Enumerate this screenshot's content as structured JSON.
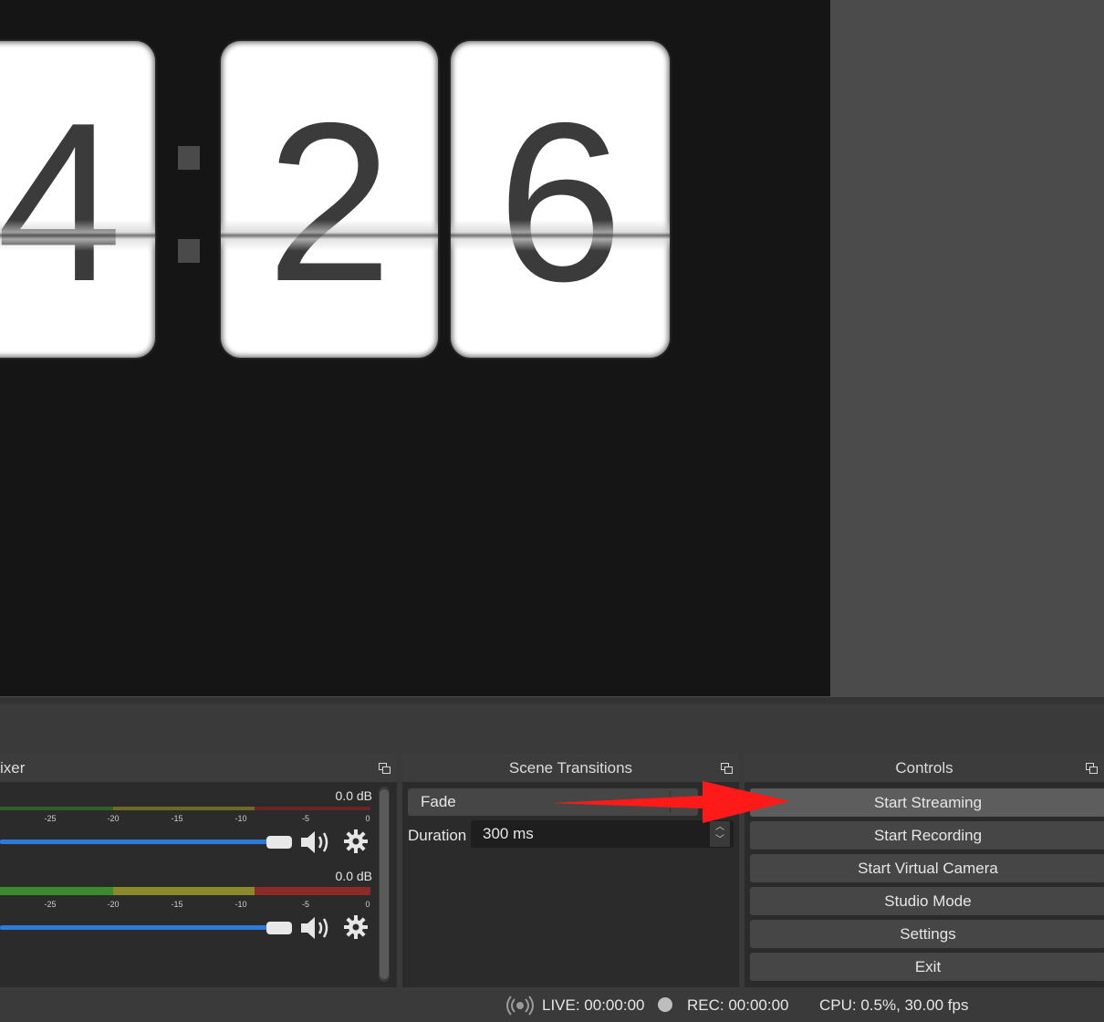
{
  "preview": {
    "clock_digits": [
      "4",
      "2",
      "6"
    ],
    "colon": ":"
  },
  "mixer": {
    "title_fragment": "ixer",
    "channels": [
      {
        "db": "0.0 dB"
      },
      {
        "db": "0.0 dB"
      }
    ],
    "tick_labels": [
      "-25",
      "-20",
      "-15",
      "-10",
      "-5",
      "0"
    ]
  },
  "transitions": {
    "title": "Scene Transitions",
    "selected_transition": "Fade",
    "duration_label": "Duration",
    "duration_value": "300 ms"
  },
  "controls": {
    "title": "Controls",
    "buttons": [
      "Start Streaming",
      "Start Recording",
      "Start Virtual Camera",
      "Studio Mode",
      "Settings",
      "Exit"
    ]
  },
  "status": {
    "live": "LIVE: 00:00:00",
    "rec": "REC: 00:00:00",
    "cpu": "CPU: 0.5%, 30.00 fps"
  },
  "colors": {
    "annotation_arrow": "#ff1a1a",
    "slider": "#2e7ad8",
    "meter_green": "#3c8a2c",
    "meter_yellow": "#8a8a2a",
    "meter_red": "#8c2a2a"
  },
  "icons": [
    "undock-icon",
    "speaker-icon",
    "gear-icon",
    "live-broadcast-icon",
    "record-dot-icon",
    "chevron-down-icon",
    "arrow-annotation"
  ]
}
